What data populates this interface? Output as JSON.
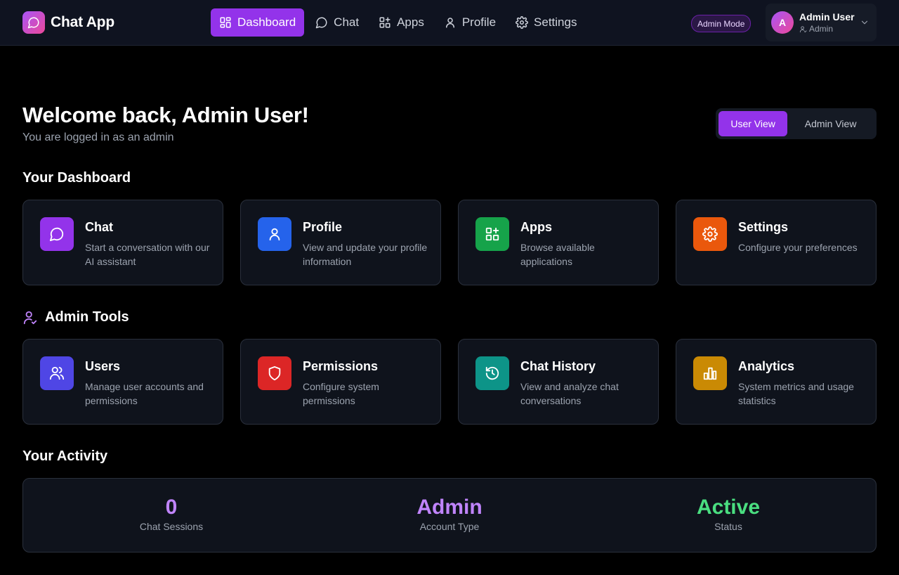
{
  "app": {
    "name": "Chat App"
  },
  "nav": {
    "items": [
      {
        "label": "Dashboard",
        "icon": "dashboard-icon",
        "active": true
      },
      {
        "label": "Chat",
        "icon": "chat-bubble-icon",
        "active": false
      },
      {
        "label": "Apps",
        "icon": "apps-grid-icon",
        "active": false
      },
      {
        "label": "Profile",
        "icon": "user-icon",
        "active": false
      },
      {
        "label": "Settings",
        "icon": "gear-icon",
        "active": false
      }
    ]
  },
  "header": {
    "mode_badge": "Admin Mode",
    "user": {
      "initial": "A",
      "name": "Admin User",
      "role": "Admin"
    }
  },
  "welcome": {
    "title": "Welcome back, Admin User!",
    "subtitle": "You are logged in as an admin"
  },
  "view_toggle": {
    "user_label": "User View",
    "admin_label": "Admin View",
    "selected": "User View"
  },
  "dashboard": {
    "title": "Your Dashboard",
    "cards": [
      {
        "title": "Chat",
        "desc": "Start a conversation with our AI assistant",
        "icon": "chat-bubble-icon",
        "color": "#9333ea"
      },
      {
        "title": "Profile",
        "desc": "View and update your profile information",
        "icon": "user-icon",
        "color": "#2563eb"
      },
      {
        "title": "Apps",
        "desc": "Browse available applications",
        "icon": "apps-grid-icon",
        "color": "#16a34a"
      },
      {
        "title": "Settings",
        "desc": "Configure your preferences",
        "icon": "gear-icon",
        "color": "#ea580c"
      }
    ]
  },
  "admin_tools": {
    "title": "Admin Tools",
    "cards": [
      {
        "title": "Users",
        "desc": "Manage user accounts and permissions",
        "icon": "users-icon",
        "color": "#4f46e5"
      },
      {
        "title": "Permissions",
        "desc": "Configure system permissions",
        "icon": "shield-icon",
        "color": "#dc2626"
      },
      {
        "title": "Chat History",
        "desc": "View and analyze chat conversations",
        "icon": "history-icon",
        "color": "#0d9488"
      },
      {
        "title": "Analytics",
        "desc": "System metrics and usage statistics",
        "icon": "bar-chart-icon",
        "color": "#ca8a04"
      }
    ]
  },
  "activity": {
    "title": "Your Activity",
    "stats": [
      {
        "value": "0",
        "label": "Chat Sessions",
        "color": "#c084fc"
      },
      {
        "value": "Admin",
        "label": "Account Type",
        "color": "#c084fc"
      },
      {
        "value": "Active",
        "label": "Status",
        "color": "#4ade80"
      }
    ]
  },
  "colors": {
    "accent": "#9333ea",
    "background": "#000000",
    "card": "#0f131c"
  }
}
